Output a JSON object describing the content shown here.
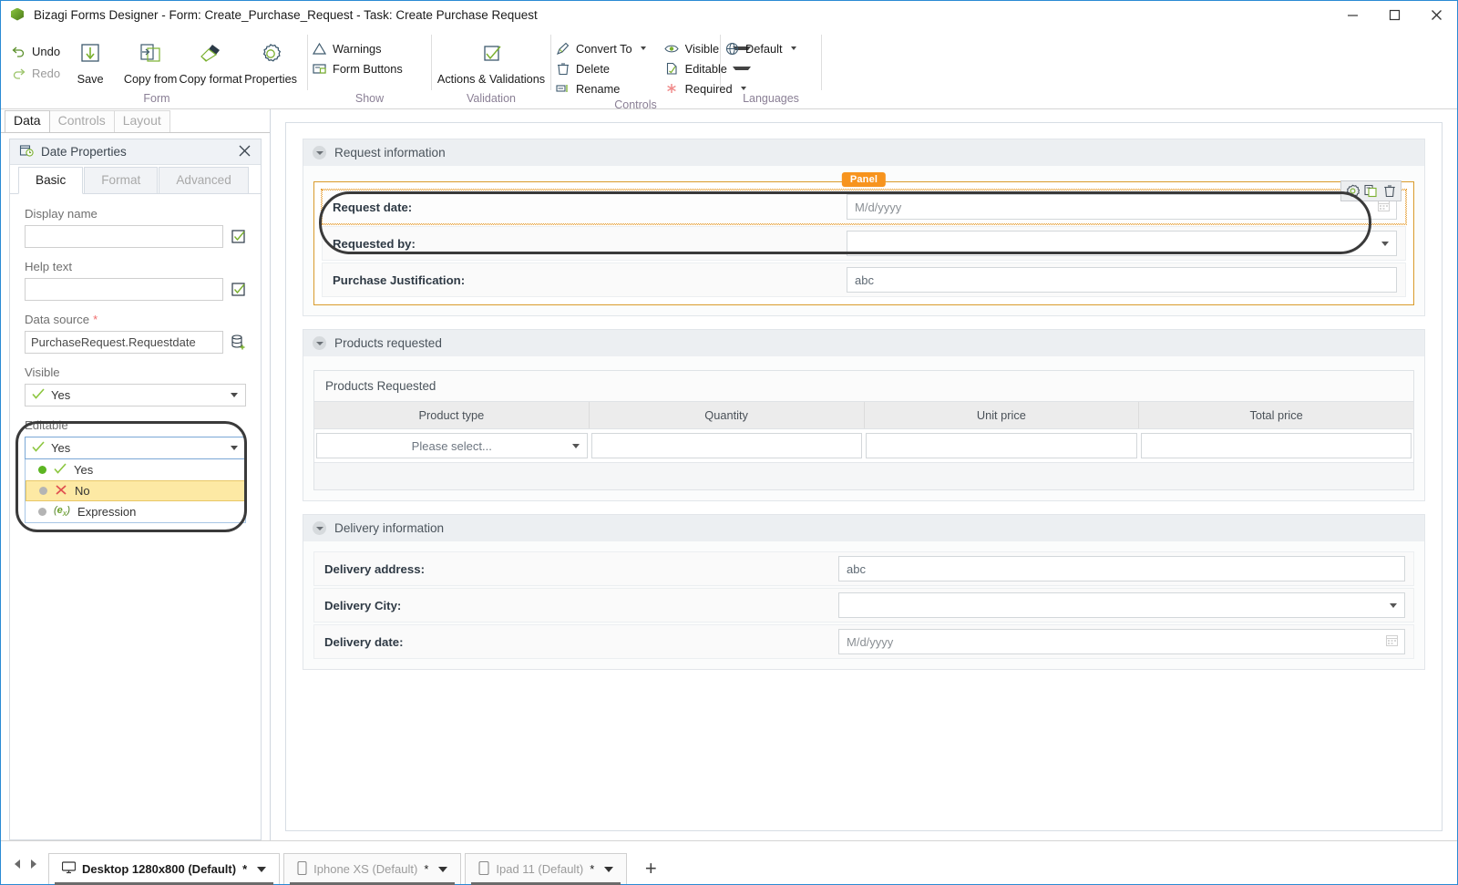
{
  "window": {
    "title": "Bizagi Forms Designer  - Form: Create_Purchase_Request - Task:  Create Purchase Request",
    "app_icon": "bizagi-cube-icon",
    "minimize": "minimize-icon",
    "maximize": "maximize-icon",
    "close": "close-icon"
  },
  "ribbon": {
    "undo": "Undo",
    "redo": "Redo",
    "groups": [
      {
        "label": "Form"
      },
      {
        "label": "Show"
      },
      {
        "label": "Validation"
      },
      {
        "label": "Controls"
      },
      {
        "label": "Languages"
      }
    ],
    "form": {
      "save": "Save",
      "copy_from": "Copy from",
      "copy_format": "Copy format",
      "properties": "Properties"
    },
    "show": {
      "warnings": "Warnings",
      "form_buttons": "Form Buttons"
    },
    "validation": {
      "actions_validations": "Actions & Validations"
    },
    "controls": {
      "convert_to": "Convert To",
      "delete": "Delete",
      "rename": "Rename",
      "visible": "Visible",
      "editable": "Editable",
      "required": "Required"
    },
    "languages": {
      "default": "Default"
    }
  },
  "left_panel": {
    "tabs": [
      {
        "label": "Data",
        "active": true
      },
      {
        "label": "Controls",
        "active": false
      },
      {
        "label": "Layout",
        "active": false
      }
    ],
    "properties": {
      "icon": "date-properties-icon",
      "title": "Date Properties",
      "close": "close-icon",
      "subtabs": [
        {
          "label": "Basic",
          "active": true
        },
        {
          "label": "Format",
          "active": false
        },
        {
          "label": "Advanced",
          "active": false
        }
      ],
      "fields": {
        "display_name": {
          "label": "Display name",
          "value": "",
          "side_icon": "check-box-icon"
        },
        "help_text": {
          "label": "Help text",
          "value": "",
          "side_icon": "check-box-icon"
        },
        "data_source": {
          "label": "Data source",
          "required_mark": "*",
          "value": "PurchaseRequest.Requestdate",
          "side_icon": "database-add-icon"
        },
        "visible": {
          "label": "Visible",
          "value": "Yes",
          "icon": "check-icon"
        },
        "editable": {
          "label": "Editable",
          "value": "Yes",
          "icon": "check-icon",
          "expanded": true,
          "options": [
            {
              "label": "Yes",
              "icon": "check-icon",
              "selected": true,
              "highlighted": false
            },
            {
              "label": "No",
              "icon": "cross-icon",
              "selected": false,
              "highlighted": true
            },
            {
              "label": "Expression",
              "icon": "expression-icon",
              "selected": false,
              "highlighted": false
            }
          ]
        }
      }
    }
  },
  "canvas": {
    "sections": [
      {
        "title": "Request information",
        "panel_tag": "Panel",
        "rows": [
          {
            "label": "Request date:",
            "control": "date",
            "placeholder": "M/d/yyyy",
            "value": "",
            "selected": true,
            "toolbar": [
              "gear-icon",
              "duplicate-icon",
              "trash-icon"
            ]
          },
          {
            "label": "Requested by:",
            "control": "dropdown",
            "placeholder": "",
            "value": "",
            "selected": false
          },
          {
            "label": "Purchase Justification:",
            "control": "text",
            "placeholder": "",
            "value": "abc",
            "selected": false
          }
        ]
      },
      {
        "title": "Products requested",
        "grid": {
          "title": "Products Requested",
          "columns": [
            "Product type",
            "Quantity",
            "Unit price",
            "Total price"
          ],
          "rows": [
            [
              {
                "type": "dropdown",
                "value": "Please select..."
              },
              {
                "type": "text",
                "value": ""
              },
              {
                "type": "text",
                "value": ""
              },
              {
                "type": "text",
                "value": ""
              }
            ]
          ]
        }
      },
      {
        "title": "Delivery information",
        "rows": [
          {
            "label": "Delivery address:",
            "control": "text",
            "placeholder": "",
            "value": "abc"
          },
          {
            "label": "Delivery City:",
            "control": "dropdown",
            "placeholder": "",
            "value": ""
          },
          {
            "label": "Delivery date:",
            "control": "date",
            "placeholder": "M/d/yyyy",
            "value": "",
            "calendar_icon": "calendar-icon"
          }
        ]
      }
    ]
  },
  "statusbar": {
    "prev": "prev-arrow-icon",
    "next": "next-arrow-icon",
    "tabs": [
      {
        "label": "Desktop 1280x800 (Default)",
        "star": "*",
        "icon": "monitor-icon",
        "active": true
      },
      {
        "label": "Iphone XS (Default)",
        "star": "*",
        "icon": "phone-icon",
        "active": false
      },
      {
        "label": "Ipad 11 (Default)",
        "star": "*",
        "icon": "tablet-icon",
        "active": false
      }
    ],
    "add": "+"
  },
  "colors": {
    "accent_blue": "#2a8ad4",
    "panel_orange": "#f7941e",
    "highlight_yellow": "#fde9a4",
    "green": "#5cb522",
    "red": "#e05050"
  }
}
